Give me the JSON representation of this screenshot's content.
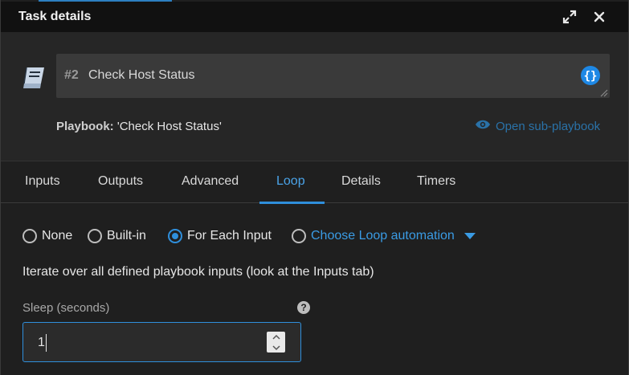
{
  "window": {
    "title": "Task details"
  },
  "task": {
    "number": "#2",
    "name": "Check Host Status"
  },
  "playbook": {
    "label": "Playbook:",
    "value": "'Check Host Status'",
    "open_link": "Open sub-playbook"
  },
  "tabs": [
    {
      "label": "Inputs"
    },
    {
      "label": "Outputs"
    },
    {
      "label": "Advanced"
    },
    {
      "label": "Loop",
      "active": true
    },
    {
      "label": "Details"
    },
    {
      "label": "Timers"
    }
  ],
  "loop": {
    "options": [
      {
        "label": "None",
        "checked": false
      },
      {
        "label": "Built-in",
        "checked": false
      },
      {
        "label": "For Each Input",
        "checked": true
      },
      {
        "label": "Choose Loop automation",
        "checked": false
      }
    ],
    "description": "Iterate over all defined playbook inputs (look at the Inputs tab)",
    "sleep_label": "Sleep (seconds)",
    "sleep_value": "1"
  },
  "colors": {
    "accent": "#2f8fdc",
    "background": "#1f1f1f",
    "titlebar": "#111111"
  }
}
